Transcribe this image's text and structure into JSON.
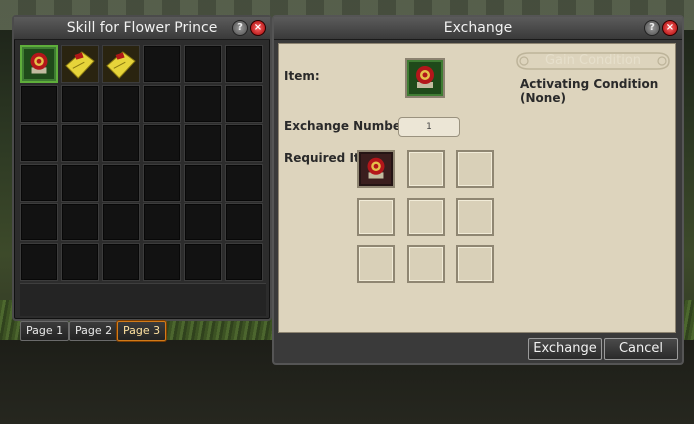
{
  "inventory": {
    "title": "Skill for Flower Prince",
    "help_glyph": "?",
    "close_glyph": "×",
    "slots": [
      {
        "item": "flower-medallion-icon",
        "selected": true
      },
      {
        "item": "golden-scroll-icon",
        "selected": false
      },
      {
        "item": "golden-scroll-icon",
        "selected": false
      }
    ],
    "columns": 6,
    "rows": 6,
    "pages": [
      {
        "label": "Page 1",
        "active": false
      },
      {
        "label": "Page 2",
        "active": false
      },
      {
        "label": "Page 3",
        "active": true
      }
    ]
  },
  "exchange": {
    "title": "Exchange",
    "help_glyph": "?",
    "close_glyph": "×",
    "item_label": "Item:",
    "item_icon": "flower-medallion-icon",
    "exchange_number_label": "Exchange Number",
    "exchange_number_value": "1",
    "required_label": "Required Ite",
    "required_items": [
      "red-flower-medallion-icon",
      "",
      "",
      "",
      "",
      "",
      "",
      "",
      ""
    ],
    "gain_condition_title": "Gain Condition",
    "gain_condition_text": "Activating Condition (None)",
    "exchange_button": "Exchange",
    "cancel_button": "Cancel"
  },
  "colors": {
    "selected_border": "#5fae3b",
    "active_tab": "#d27b1a",
    "close_red": "#a30000",
    "parchment": "#ddd4bd"
  }
}
